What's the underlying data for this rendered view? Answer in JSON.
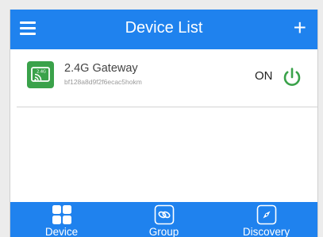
{
  "header": {
    "title": "Device List",
    "menu_icon": "menu-icon",
    "add_label": "+"
  },
  "devices": [
    {
      "name": "2.4G Gateway",
      "id": "bf128a8d9f2f6ecac5hokm",
      "icon_text": "2.4G",
      "status": "ON",
      "icon": "gateway-icon",
      "power_icon": "power-icon"
    }
  ],
  "tabs": [
    {
      "label": "Device",
      "icon": "grid-icon"
    },
    {
      "label": "Group",
      "icon": "link-icon"
    },
    {
      "label": "Discovery",
      "icon": "compass-icon"
    }
  ],
  "colors": {
    "primary": "#1f82ee",
    "device_icon_bg": "#3aa24a",
    "power_green": "#3aa24a"
  }
}
